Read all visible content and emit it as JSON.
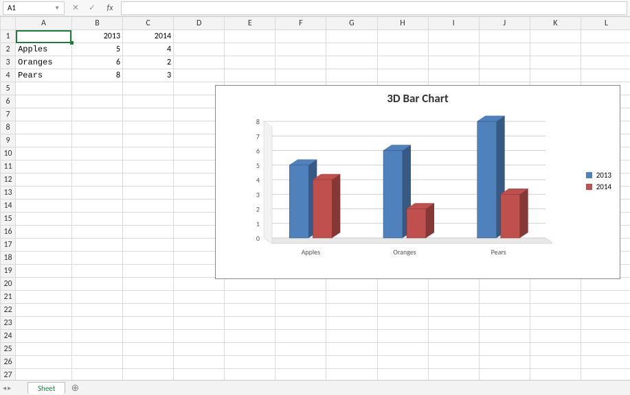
{
  "formula_bar": {
    "name_box": "A1",
    "cancel_glyph": "✕",
    "accept_glyph": "✓",
    "fx_label": "fx"
  },
  "columns": [
    "A",
    "B",
    "C",
    "D",
    "E",
    "F",
    "G",
    "H",
    "I",
    "J",
    "K",
    "L"
  ],
  "row_count": 27,
  "cells": {
    "B1": "2013",
    "C1": "2014",
    "A2": "Apples",
    "B2": "5",
    "C2": "4",
    "A3": "Oranges",
    "B3": "6",
    "C3": "2",
    "A4": "Pears",
    "B4": "8",
    "C4": "3"
  },
  "selected_cell": "A1",
  "chart_data": {
    "type": "bar",
    "title": "3D Bar Chart",
    "categories": [
      "Apples",
      "Oranges",
      "Pears"
    ],
    "series": [
      {
        "name": "2013",
        "values": [
          5,
          6,
          8
        ],
        "color": "#4f81bd"
      },
      {
        "name": "2014",
        "values": [
          4,
          2,
          3
        ],
        "color": "#c0504d"
      }
    ],
    "ylim": [
      0,
      8
    ],
    "ystep": 1,
    "xlabel": "",
    "ylabel": ""
  },
  "tabs": {
    "active": "Sheet",
    "add_glyph": "⊕"
  }
}
